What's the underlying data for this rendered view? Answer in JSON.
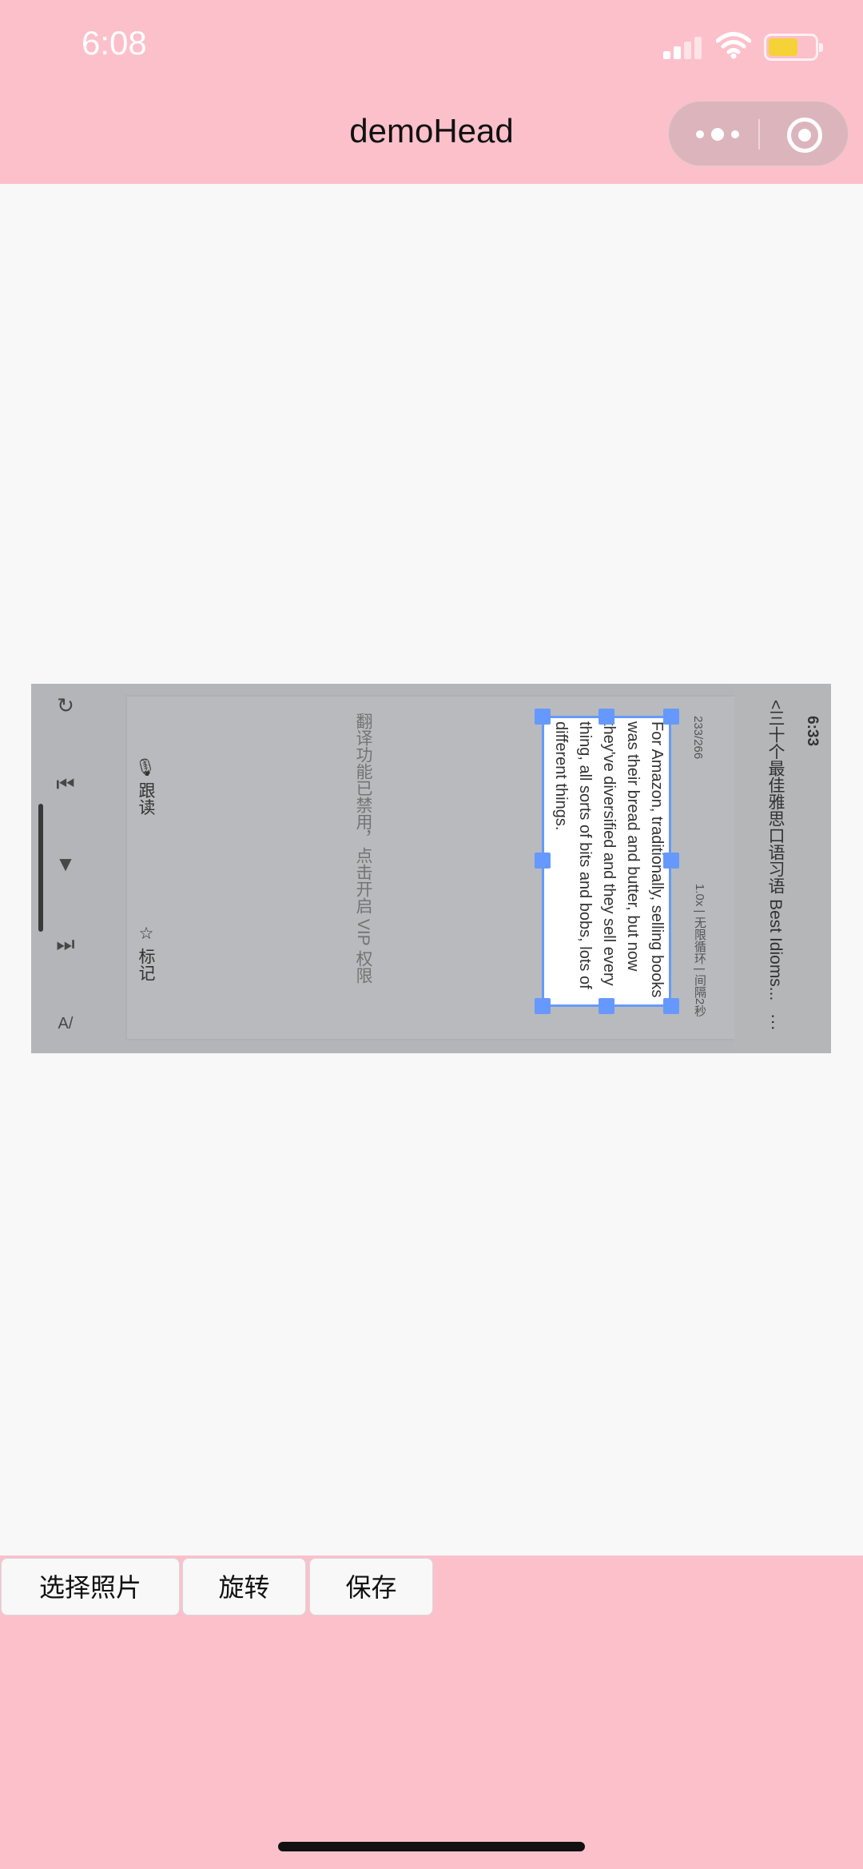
{
  "status_bar": {
    "time": "6:08"
  },
  "header": {
    "title": "demoHead"
  },
  "screenshot": {
    "status_time": "6:33",
    "nav_title": "三十个最佳雅思口语习语 Best Idioms...",
    "back_arrow": "<",
    "more_dots": "···",
    "counter": "233/266",
    "playback_info": "1.0x | 无限循环 | 间隔2秒",
    "selected_text": "For Amazon, traditionally, selling books was their bread and butter, but now they've diversified and they sell every thing, all sorts of bits and bobs, lots of different things.",
    "translation_notice": "翻译功能已禁用，点击开启 VIP 权限",
    "follow_read": "跟读",
    "mark": "标记"
  },
  "toolbar": {
    "choose_photo": "选择照片",
    "rotate": "旋转",
    "save": "保存"
  }
}
